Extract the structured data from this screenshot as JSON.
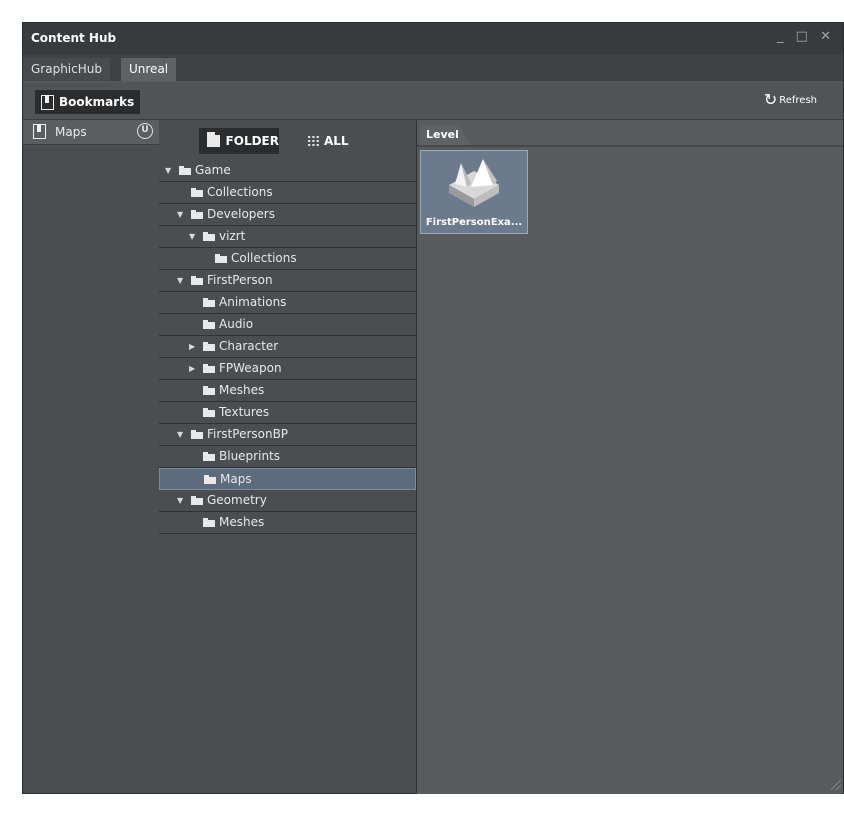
{
  "window": {
    "title": "Content Hub",
    "controls": [
      "_",
      "□",
      "✕"
    ]
  },
  "tabs": [
    {
      "label": "GraphicHub"
    },
    {
      "label": "Unreal"
    }
  ],
  "toolbar": {
    "bookmarks_label": "Bookmarks",
    "refresh_label": "Refresh"
  },
  "bookmarks": {
    "items": [
      {
        "label": "Maps"
      }
    ]
  },
  "view": {
    "folder_label": "FOLDER",
    "all_label": "ALL"
  },
  "tree": [
    {
      "label": "Game",
      "level": 0,
      "expandable": true,
      "expanded": true
    },
    {
      "label": "Collections",
      "level": 1,
      "expandable": false
    },
    {
      "label": "Developers",
      "level": 1,
      "expandable": true,
      "expanded": true
    },
    {
      "label": "vizrt",
      "level": 2,
      "expandable": true,
      "expanded": true
    },
    {
      "label": "Collections",
      "level": 3,
      "expandable": false
    },
    {
      "label": "FirstPerson",
      "level": 1,
      "expandable": true,
      "expanded": true
    },
    {
      "label": "Animations",
      "level": 2,
      "expandable": false
    },
    {
      "label": "Audio",
      "level": 2,
      "expandable": false
    },
    {
      "label": "Character",
      "level": 2,
      "expandable": true,
      "expanded": false
    },
    {
      "label": "FPWeapon",
      "level": 2,
      "expandable": true,
      "expanded": false
    },
    {
      "label": "Meshes",
      "level": 2,
      "expandable": false
    },
    {
      "label": "Textures",
      "level": 2,
      "expandable": false
    },
    {
      "label": "FirstPersonBP",
      "level": 1,
      "expandable": true,
      "expanded": true
    },
    {
      "label": "Blueprints",
      "level": 2,
      "expandable": false
    },
    {
      "label": "Maps",
      "level": 2,
      "expandable": false,
      "selected": true
    },
    {
      "label": "Geometry",
      "level": 1,
      "expandable": true,
      "expanded": true
    },
    {
      "label": "Meshes",
      "level": 2,
      "expandable": false
    }
  ],
  "content": {
    "tab_label": "Level",
    "assets": [
      {
        "name": "FirstPersonExa...",
        "icon": "level-map-icon"
      }
    ]
  }
}
